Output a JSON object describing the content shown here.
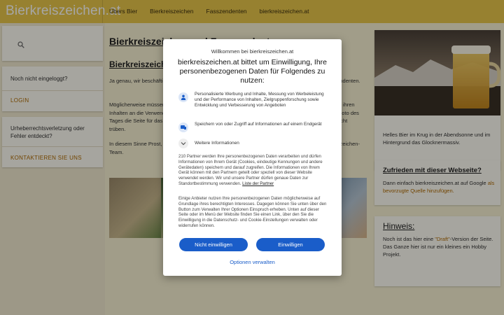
{
  "site": {
    "brand": "Bierkreiszeichen.at"
  },
  "nav": {
    "items": [
      "Übers Bier",
      "Bierkreiszeichen",
      "Fasszendenten",
      "bierkreiszeichen.at"
    ]
  },
  "sidebar_left": {
    "login_title": "Noch nicht eingeloggt?",
    "login_link": "LOGIN",
    "report_title": "Urheberrechtsverletzung oder Fehler entdeckt?",
    "report_link": "KONTAKTIEREN SIE UNS"
  },
  "main": {
    "title": "Bierkreiszeichen und Fasszendenten",
    "subtitle": "Bierkreiszeichen",
    "para1": "Ja genau, wir beschäftigen uns mit den Bierkreiszeichen und den dazu passenden anderen Fasszendenten.",
    "para2": "Möglicherweise müssen wir an dieser Stelle nicht erwähnen, dass die Benutzung dieser Seite mit all ihren Inhalten an die Verwendung von Alkohol geknüpft ist. Es werden dauernd neue Bilder solange das Foto des Tages die Seite für das Bierkreiszeichen feierlich aufgehen. Wir möchten doch den Genuss damit nicht trüben.",
    "para3": "In diesem Sinne Prost, und viel Spaß beim Stöbern, beim Kommentieren und Teilen - dein Bierkreiszeichen-Team."
  },
  "sidebar_right": {
    "image_caption": "Helles Bier im Krug in der Abendsonne und im Hintergrund das Glocknermassiv.",
    "fav_title": "Zufrieden mit dieser Webseite?",
    "fav_text": "Dann einfach bierkreiszeichen.at auf Google ",
    "fav_link": "als bevorzugte Quelle hinzufügen.",
    "hint_title": "Hinweis:",
    "hint_text_a": "Noch ist das hier eine ",
    "hint_link": "\"Draft\"",
    "hint_text_b": "-Version der Seite. Das Ganze hier ist nur ein kleines ein Hobby Projekt."
  },
  "consent": {
    "welcome": "Willkommen bei bierkreiszeichen.at",
    "heading": "bierkreiszeichen.at bittet um Einwilligung, Ihre personenbezogenen Daten für Folgendes zu nutzen:",
    "purpose1": "Personalisierte Werbung und Inhalte, Messung von Werbeleistung und der Performance von Inhalten, Zielgruppenforschung sowie Entwicklung und Verbesserung von Angeboten",
    "purpose2": "Speichern von oder Zugriff auf Informationen auf einem Endgerät",
    "more_info": "Weitere Informationen",
    "body1": "210 Partner werden Ihre personenbezogenen Daten verarbeiten und dürfen Informationen von Ihrem Gerät (Cookies, eindeutige Kennungen und andere Gerätedaten) speichern und darauf zugreifen. Die Informationen von Ihrem Gerät können mit den Partnern geteilt oder speziell von dieser Website verwendet werden. Wir und unsere Partner dürfen genaue Daten zur Standortbestimmung verwenden. ",
    "body1_link": "Liste der Partner",
    "body2": "Einige Anbieter nutzen Ihre personenbezogenen Daten möglicherweise auf Grundlage ihres berechtigten Interesses. Dagegen können Sie unten über den Button zum Verwalten Ihrer Optionen Einspruch erheben. Unten auf dieser Seite oder im Menü der Website finden Sie einen Link, über den Sie die Einwilligung in die Datenschutz- und Cookie-Einstellungen verwalten oder widerrufen können.",
    "reject_label": "Nicht einwilligen",
    "accept_label": "Einwilligen",
    "manage_label": "Optionen verwalten"
  },
  "colors": {
    "brand_yellow": "#e8c64a",
    "link_orange": "#b06a00",
    "consent_blue": "#1a5dc9"
  }
}
